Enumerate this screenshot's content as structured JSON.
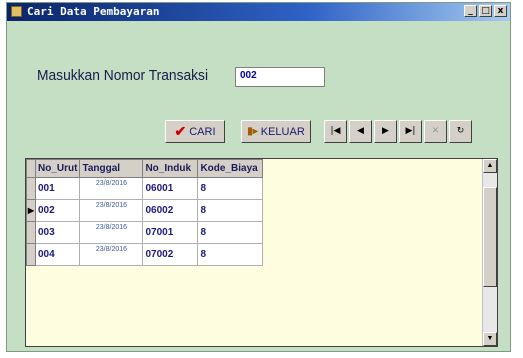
{
  "window": {
    "title": "Cari Data Pembayaran",
    "min_glyph": "_",
    "max_glyph": "□",
    "close_glyph": "x"
  },
  "form": {
    "label": "Masukkan Nomor Transaksi",
    "input_value": "002"
  },
  "buttons": {
    "cari": "CARI",
    "keluar": "KELUAR"
  },
  "navigator": {
    "first": "|◀",
    "prior": "◀",
    "next": "▶",
    "last": "▶|",
    "delete": "✕",
    "refresh": "↻"
  },
  "grid": {
    "columns": [
      "No_Urut",
      "Tanggal",
      "No_Induk",
      "Kode_Biaya"
    ],
    "rows": [
      {
        "no_urut": "001",
        "tanggal": "23/8/2016",
        "no_induk": "06001",
        "kode_biaya": "8"
      },
      {
        "no_urut": "002",
        "tanggal": "23/8/2016",
        "no_induk": "06002",
        "kode_biaya": "8"
      },
      {
        "no_urut": "003",
        "tanggal": "23/8/2016",
        "no_induk": "07001",
        "kode_biaya": "8"
      },
      {
        "no_urut": "004",
        "tanggal": "23/8/2016",
        "no_induk": "07002",
        "kode_biaya": "8"
      }
    ],
    "current_row_marker": "▶"
  },
  "colors": {
    "form_bg": "#c5dfc4",
    "grid_bg": "#fffde0",
    "title_start": "#0a246a",
    "title_end": "#a6caf0"
  }
}
